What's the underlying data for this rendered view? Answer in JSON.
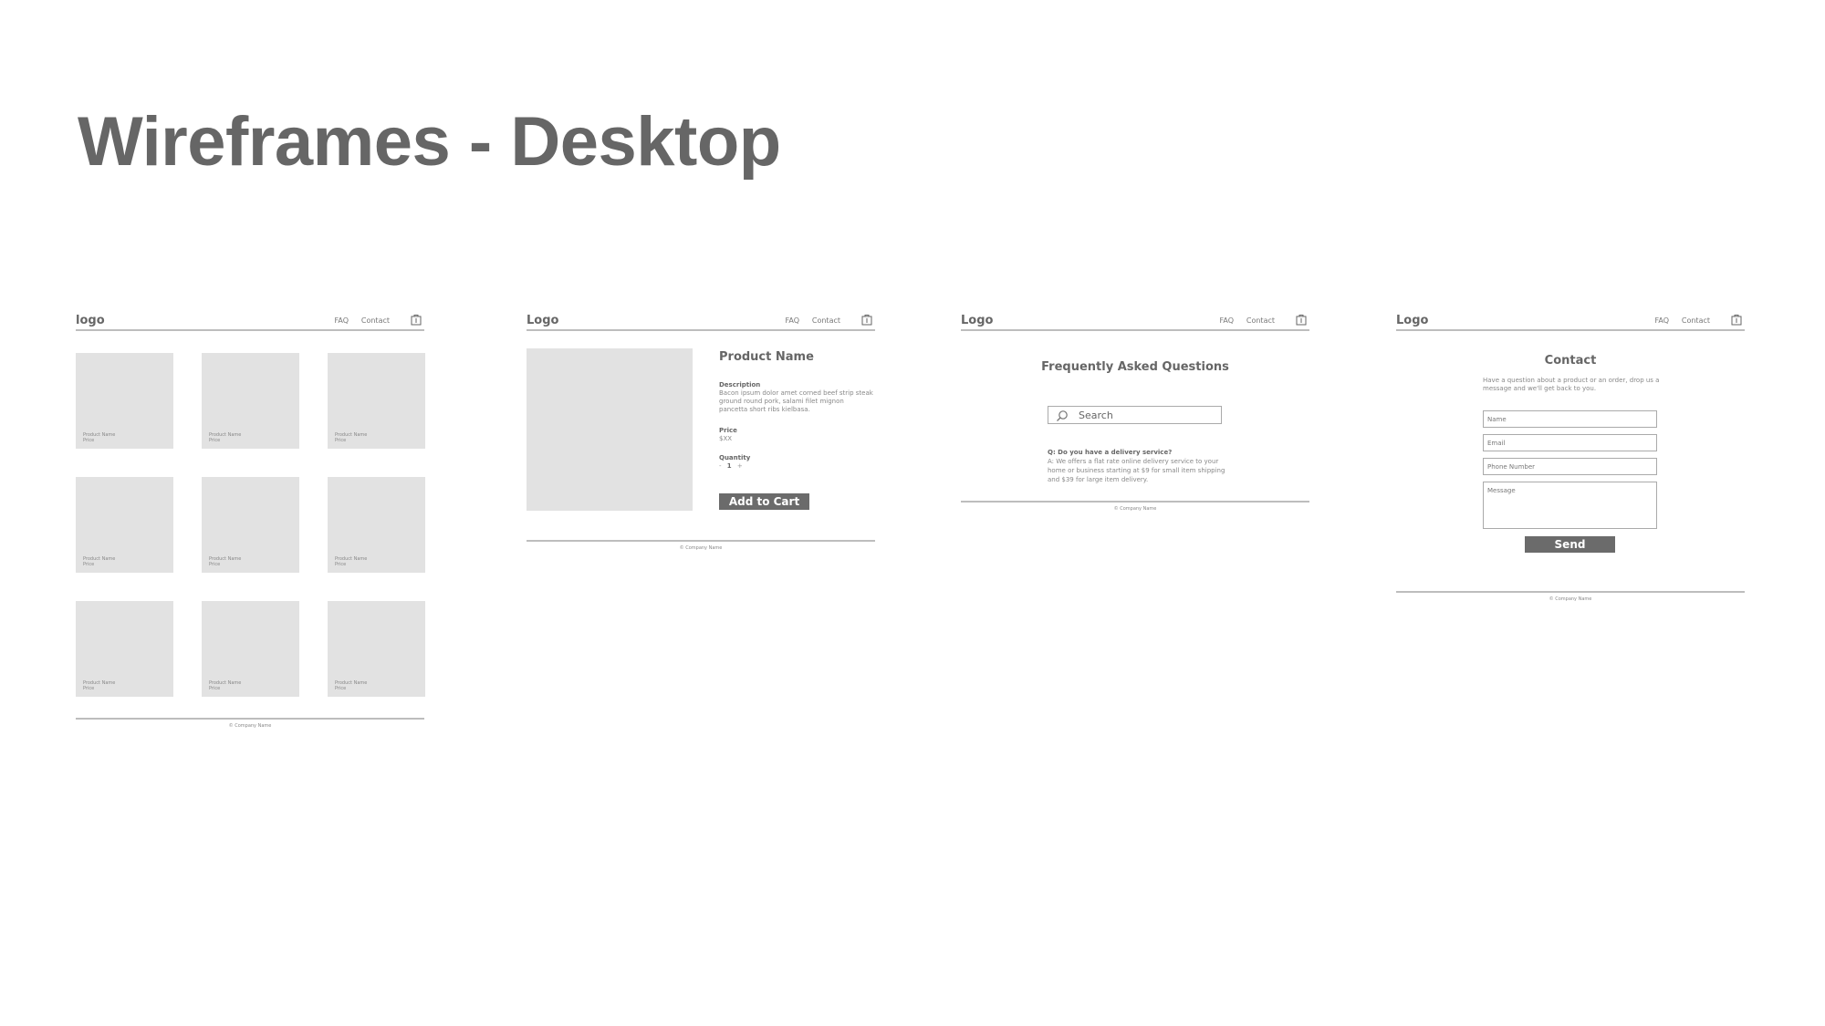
{
  "page": {
    "title": "Wireframes - Desktop"
  },
  "common": {
    "nav_faq": "FAQ",
    "nav_contact": "Contact",
    "footer": "© Company Name",
    "cart_icon": "shopping-bag-icon"
  },
  "frame1": {
    "logo": "logo",
    "product_name": "Product Name",
    "price": "Price"
  },
  "frame2": {
    "logo": "Logo",
    "product_name": "Product Name",
    "description_label": "Description",
    "description_text": "Bacon ipsum dolor amet corned beef strip steak ground round pork, salami filet mignon pancetta short ribs kielbasa.",
    "price_label": "Price",
    "price_value": "$XX",
    "quantity_label": "Quantity",
    "qty_minus": "-",
    "qty_value": "1",
    "qty_plus": "+",
    "add_to_cart": "Add to Cart"
  },
  "frame3": {
    "logo": "Logo",
    "heading": "Frequently Asked Questions",
    "search_placeholder": "Search",
    "question": "Q: Do you have a delivery service?",
    "answer": "A: We offers a flat rate online delivery service to your home or business starting at $9 for small item shipping and $39 for large item delivery."
  },
  "frame4": {
    "logo": "Logo",
    "heading": "Contact",
    "subtext": "Have a question about a product or an order, drop us a message and we'll get back to you.",
    "name_field": "Name",
    "email_field": "Email",
    "phone_field": "Phone Number",
    "message_field": "Message",
    "send": "Send"
  },
  "colors": {
    "accent": "#6b6b6b",
    "placeholder": "#e2e2e2",
    "rule": "#bdbdbd"
  }
}
